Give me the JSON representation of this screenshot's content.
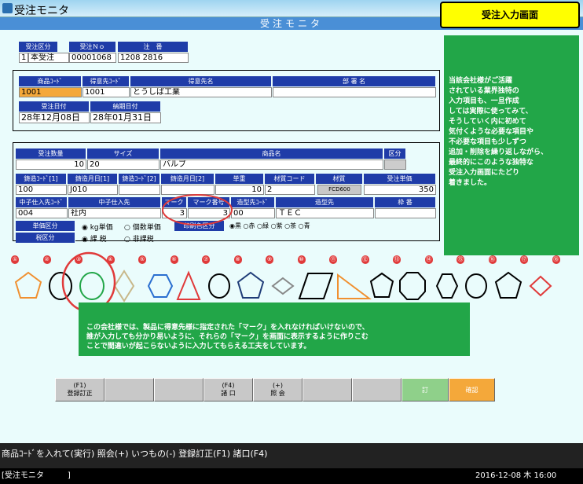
{
  "window": {
    "title": "受注モニタ",
    "header": "受注モニタ",
    "screen_label": "受注入力画面"
  },
  "order": {
    "labels": [
      "受注区分",
      "受注Ｎｏ",
      "注　番"
    ],
    "kubun_code": "1",
    "kubun_name": "本受注",
    "order_no": "00001068",
    "chuban": "1208 2816"
  },
  "customer": {
    "labels": [
      "商品ｺｰﾄﾞ",
      "得意先ｺｰﾄﾞ",
      "得意先名",
      "部 署 名"
    ],
    "product_code": "1001",
    "cust_code": "1001",
    "cust_name": "とうしば工業",
    "dept": "",
    "date_labels": [
      "受注日付",
      "納期日付"
    ],
    "order_date": "28年12月08日",
    "due_date": "28年01月31日"
  },
  "item": {
    "labels1": [
      "受注数量",
      "サイズ",
      "商品名",
      "区分"
    ],
    "qty": "10",
    "size": "20",
    "name": "バルブ",
    "labels2": [
      "鋳造ｺｰﾄﾞ[1]",
      "鋳造月日[1]",
      "鋳造ｺｰﾄﾞ[2]",
      "鋳造月日[2]",
      "単重",
      "材質コード",
      "材質",
      "受注単価"
    ],
    "cast_code1": "100",
    "cast_date1": "J010",
    "weight": "10",
    "material_code": "2",
    "material": "FCD600",
    "price": "350",
    "labels3": [
      "中子仕入先ｺｰﾄﾞ",
      "中子仕入先",
      "マーク",
      "マーク番号",
      "造型先ｺｰﾄﾞ",
      "造型先",
      "枠 番"
    ],
    "core_code": "004",
    "core_name": "社内",
    "mark": "3",
    "mark_no": "3",
    "mold_code": "00",
    "mold_name": "ＴＥＣ",
    "unit_label": "単価区分",
    "unit_opts": [
      "kg単価",
      "個数単価"
    ],
    "tax_label": "税区分",
    "tax_opts": [
      "課 税",
      "非課税"
    ],
    "print_label": "印刷色区分",
    "print_opts": [
      "黒",
      "赤",
      "緑",
      "紫",
      "茶",
      "青"
    ]
  },
  "note1": "当該会社様がご活躍\nされている業界独特の\n入力項目も、一旦作成\nしては実際に使ってみて、\nそうしていく内に初めて\n気付くような必要な項目や\n不必要な項目も少しずつ\n追加・削除を繰り返しながら、\n最終的にこのような独特な\n受注入力画面にたどり\n着きました。",
  "note2": "この会社様では、製品に得意先様に指定された「マーク」を入れなければいけないので、\n誰が入力しても分かり易いように、それらの「マーク」を画面に表示するように作りこむ\nことで間違いが起こらないように入力してもらえる工夫をしています。",
  "marks": [
    "①",
    "②",
    "③",
    "④",
    "⑤",
    "⑥",
    "⑦",
    "⑧",
    "⑨",
    "⑩",
    "⑪",
    "⑫",
    "⑬",
    "⑭",
    "⑮",
    "⑯",
    "⑰",
    "⑱"
  ],
  "fkeys": [
    "(F1)\n登録訂正",
    "",
    "",
    "(F4)\n諸 口",
    "(+)\n照 会",
    "",
    "",
    "訂",
    "確認"
  ],
  "status": "商品ｺｰﾄﾞを入れて(実行) 照会(+) いつもの(-) 登録訂正(F1) 諸口(F4)",
  "taskbar": {
    "left": "[受注モニタ　　　]",
    "right": "2016-12-08 木 16:00"
  },
  "colors": {
    "accent": "#1f3ca8",
    "note": "#22a648",
    "highlight": "#ffff00",
    "red": "#e03a3a"
  }
}
